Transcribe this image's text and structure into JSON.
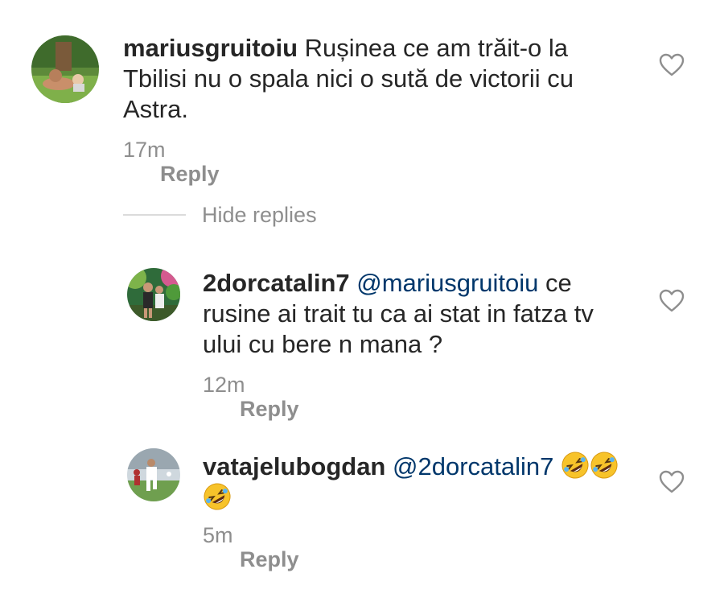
{
  "comments": [
    {
      "username": "mariusgruitoiu",
      "text": "Rușinea ce am trăit-o la Tbilisi nu o spala nici o sută de victorii cu Astra.",
      "time": "17m",
      "reply_label": "Reply"
    },
    {
      "username": "2dorcatalin7",
      "mention": "@mariusgruitoiu",
      "text": "ce rusine ai trait tu ca ai stat in fatza tv ului cu bere n mana ?",
      "time": "12m",
      "reply_label": "Reply"
    },
    {
      "username": "vatajelubogdan",
      "mention": "@2dorcatalin7",
      "emojis": [
        "rolling-on-floor-laughing",
        "rolling-on-floor-laughing",
        "rolling-on-floor-laughing"
      ],
      "time": "5m",
      "reply_label": "Reply"
    }
  ],
  "replies_toggle": {
    "label": "Hide replies"
  },
  "icons": {
    "like": "heart-outline-icon"
  },
  "colors": {
    "text": "#262626",
    "secondary": "#8e8e8e",
    "mention": "#00376b",
    "divider": "#dbdbdb"
  }
}
